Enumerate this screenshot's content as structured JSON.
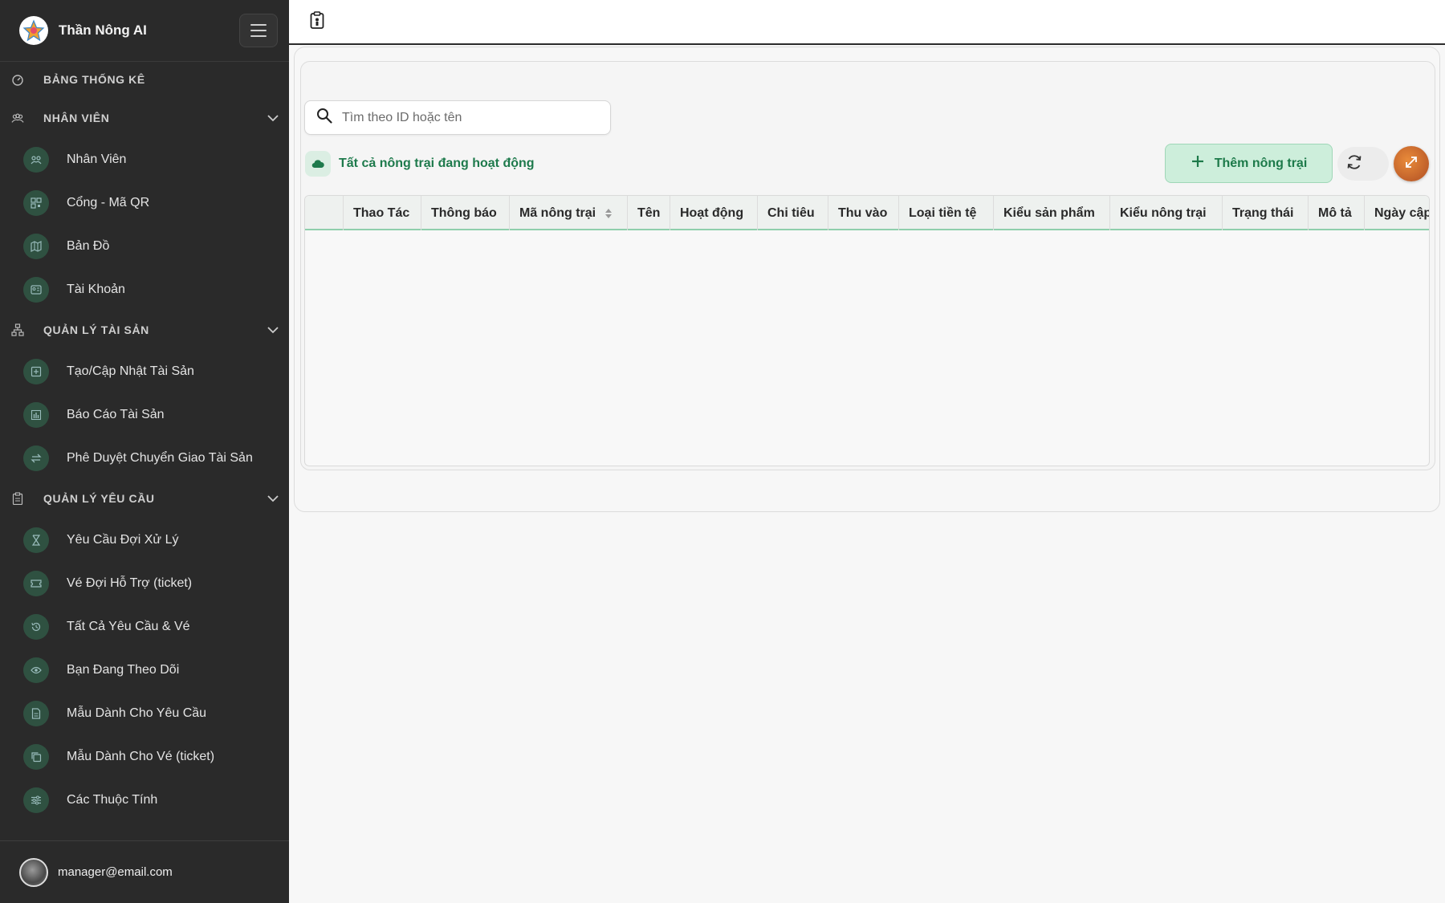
{
  "app": {
    "title": "Thần Nông AI"
  },
  "sidebar": {
    "sections": [
      {
        "label": "BẢNG THỐNG KÊ"
      },
      {
        "label": "NHÂN VIÊN"
      },
      {
        "label": "QUẢN LÝ TÀI SẢN"
      },
      {
        "label": "QUẢN LÝ YÊU CẦU"
      }
    ],
    "items": [
      {
        "label": "Nhân Viên",
        "icon": "users-icon"
      },
      {
        "label": "Cổng - Mã QR",
        "icon": "qr-code-icon"
      },
      {
        "label": "Bản Đồ",
        "icon": "map-icon"
      },
      {
        "label": "Tài Khoản",
        "icon": "id-card-icon"
      },
      {
        "label": "Tạo/Cập Nhật Tài Sản",
        "icon": "plus-square-icon"
      },
      {
        "label": "Báo Cáo Tài Sản",
        "icon": "bar-chart-icon"
      },
      {
        "label": "Phê Duyệt Chuyển Giao Tài Sản",
        "icon": "transfer-icon"
      },
      {
        "label": "Yêu Cầu Đợi Xử Lý",
        "icon": "hourglass-icon"
      },
      {
        "label": "Vé Đợi Hỗ Trợ (ticket)",
        "icon": "ticket-icon"
      },
      {
        "label": "Tất Cả Yêu Cầu & Vé",
        "icon": "history-icon"
      },
      {
        "label": "Bạn Đang Theo Dõi",
        "icon": "eye-icon"
      },
      {
        "label": "Mẫu Dành Cho Yêu Cầu",
        "icon": "document-icon"
      },
      {
        "label": "Mẫu Dành Cho Vé (ticket)",
        "icon": "copy-icon"
      },
      {
        "label": "Các Thuộc Tính",
        "icon": "sliders-icon"
      }
    ],
    "user": {
      "email": "manager@email.com"
    }
  },
  "main": {
    "search": {
      "placeholder": "Tìm theo ID hoặc tên"
    },
    "filter": {
      "label": "Tất cả nông trại đang hoạt động"
    },
    "add_button": {
      "label": "Thêm nông trại"
    },
    "table": {
      "columns": [
        "Thao Tác",
        "Thông báo",
        "Mã nông trại",
        "Tên",
        "Hoạt động",
        "Chi tiêu",
        "Thu vào",
        "Loại tiền tệ",
        "Kiểu sản phẩm",
        "Kiểu nông trại",
        "Trạng thái",
        "Mô tả",
        "Ngày cập"
      ],
      "rows": []
    }
  },
  "colors": {
    "sidebar_bg": "#2a2a2a",
    "accent_green": "#1e7a4c",
    "button_bg": "#cdeedb",
    "icon_circle": "#2f5141"
  }
}
